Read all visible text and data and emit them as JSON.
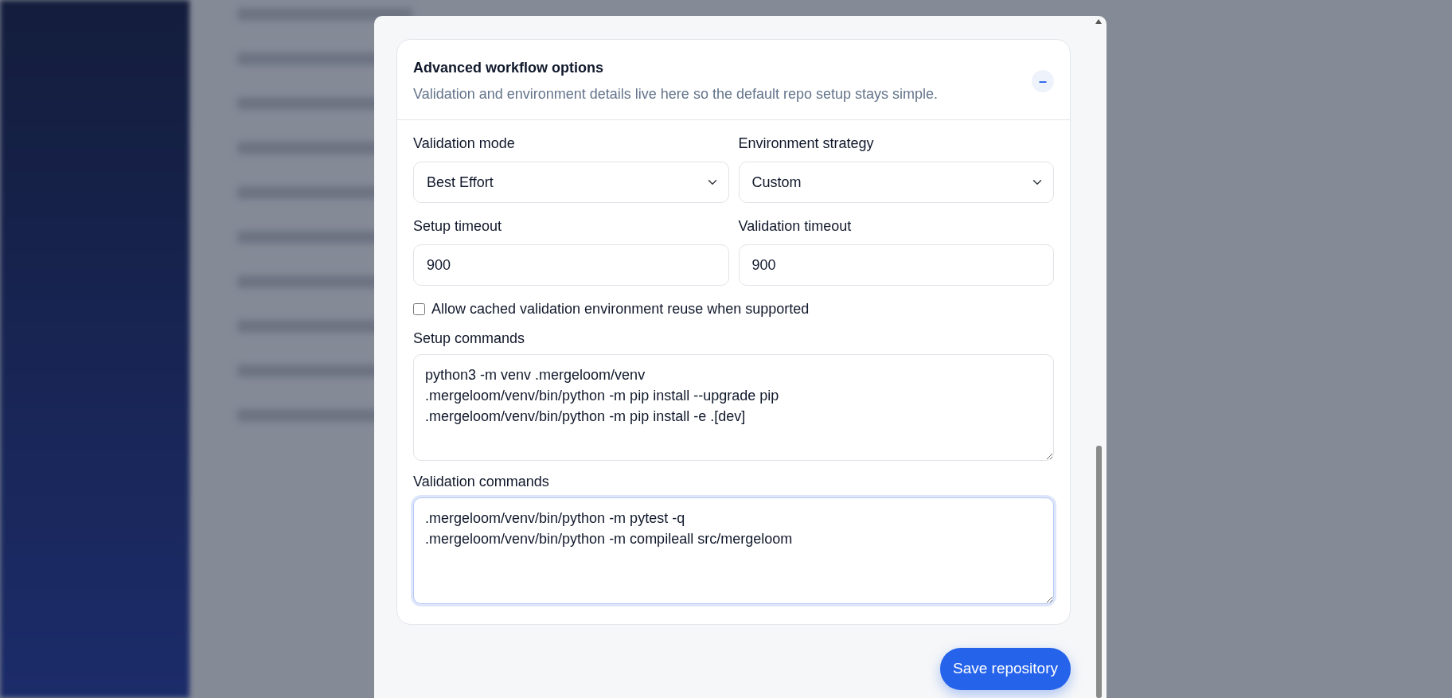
{
  "dialog": {
    "section": {
      "title": "Advanced workflow options",
      "subtitle": "Validation and environment details live here so the default repo setup stays simple.",
      "toggle": "–",
      "expanded": true,
      "fields": [
        {
          "kind": "select",
          "label": "Validation mode",
          "value": "Best Effort"
        },
        {
          "kind": "select",
          "label": "Environment strategy",
          "value": "Custom"
        },
        {
          "kind": "input",
          "label": "Setup timeout",
          "value": "900"
        },
        {
          "kind": "input",
          "label": "Validation timeout",
          "value": "900"
        },
        {
          "kind": "checkbox",
          "label": "Allow cached validation environment reuse when supported",
          "checked": false
        },
        {
          "kind": "textarea",
          "label": "Setup commands",
          "value": "python3 -m venv .mergeloom/venv\n.mergeloom/venv/bin/python -m pip install --upgrade pip\n.mergeloom/venv/bin/python -m pip install -e .[dev]",
          "focused": false
        },
        {
          "kind": "textarea",
          "label": "Validation commands",
          "value": ".mergeloom/venv/bin/python -m pytest -q\n.mergeloom/venv/bin/python -m compileall src/mergeloom",
          "focused": true
        }
      ]
    },
    "save_button": "Save repository"
  }
}
